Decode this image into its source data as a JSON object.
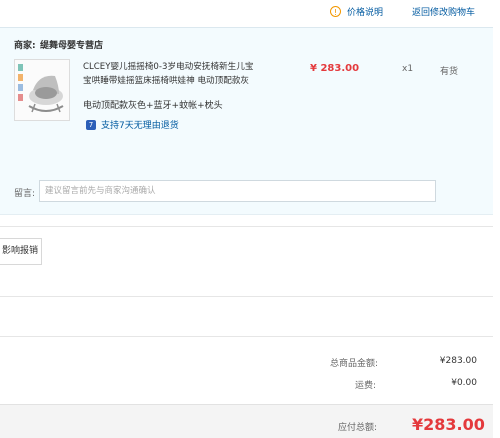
{
  "header": {
    "price_info_label": "价格说明",
    "price_info_icon": "warning-icon",
    "back_to_cart_label": "返回修改购物车"
  },
  "shop": {
    "merchant_prefix": "商家:",
    "merchant_name": "缇舞母婴专营店",
    "item": {
      "title_lines": [
        "CLCEY婴儿摇摇椅0-3岁电动安抚椅新生儿宝",
        "宝哄睡带娃摇篮床摇椅哄娃神 电动顶配款灰"
      ],
      "price": "¥ 283.00",
      "quantity": "x1",
      "stock_status": "有货",
      "spec": "电动顶配款灰色+蓝牙+蚊帐+枕头",
      "return_policy": "支持7天无理由退货",
      "return_icon_glyph": "7"
    },
    "remark": {
      "label": "留言:",
      "placeholder": "建议留言前先与商家沟通确认"
    }
  },
  "invoice": {
    "button_label": "影响报销"
  },
  "summary": {
    "total_goods_label": "总商品金额:",
    "total_goods_value": "¥283.00",
    "shipping_label": "运费:",
    "shipping_value": "¥0.00",
    "payable_label": "应付总额:",
    "payable_value": "¥283.00"
  },
  "colors": {
    "price_red": "#e4393c",
    "link_blue": "#005aa0",
    "panel_bg": "#f3fbfe"
  }
}
